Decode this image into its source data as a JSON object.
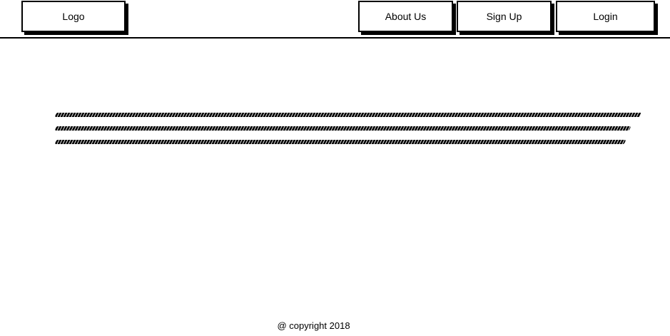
{
  "header": {
    "logo_label": "Logo",
    "nav": {
      "about_label": "About Us",
      "signup_label": "Sign Up",
      "login_label": "Login"
    }
  },
  "footer": {
    "copyright": "@ copyright 2018"
  },
  "colors": {
    "text": "#000000",
    "background": "#ffffff"
  }
}
